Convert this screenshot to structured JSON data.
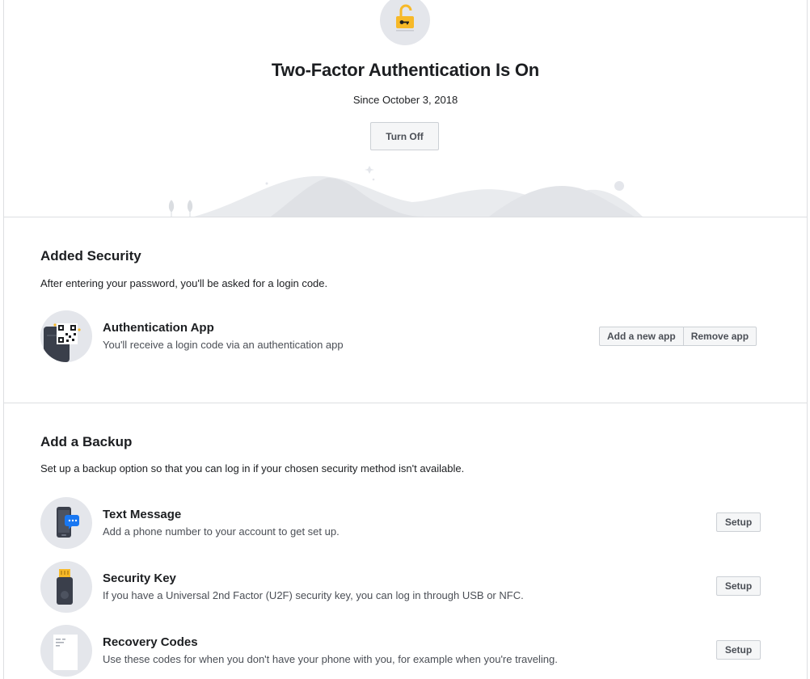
{
  "hero": {
    "title": "Two-Factor Authentication Is On",
    "since": "Since October 3, 2018",
    "turn_off_label": "Turn Off",
    "icon": "unlocked-padlock-key-icon"
  },
  "added_security": {
    "title": "Added Security",
    "description": "After entering your password, you'll be asked for a login code.",
    "method": {
      "title": "Authentication App",
      "description": "You'll receive a login code via an authentication app",
      "icon": "qr-code-phone-icon",
      "buttons": {
        "add": "Add a new app",
        "remove": "Remove app"
      }
    }
  },
  "backup": {
    "title": "Add a Backup",
    "description": "Set up a backup option so that you can log in if your chosen security method isn't available.",
    "options": [
      {
        "title": "Text Message",
        "description": "Add a phone number to your account to get set up.",
        "button": "Setup",
        "icon": "phone-message-icon"
      },
      {
        "title": "Security Key",
        "description": "If you have a Universal 2nd Factor (U2F) security key, you can log in through USB or NFC.",
        "button": "Setup",
        "icon": "usb-key-icon"
      },
      {
        "title": "Recovery Codes",
        "description": "Use these codes for when you don't have your phone with you, for example when you're traveling.",
        "button": "Setup",
        "icon": "document-codes-icon"
      }
    ]
  },
  "colors": {
    "accent_yellow": "#f7b928",
    "icon_blue": "#1877f2",
    "border": "#dddfe2",
    "icon_bg": "#e4e6eb"
  }
}
